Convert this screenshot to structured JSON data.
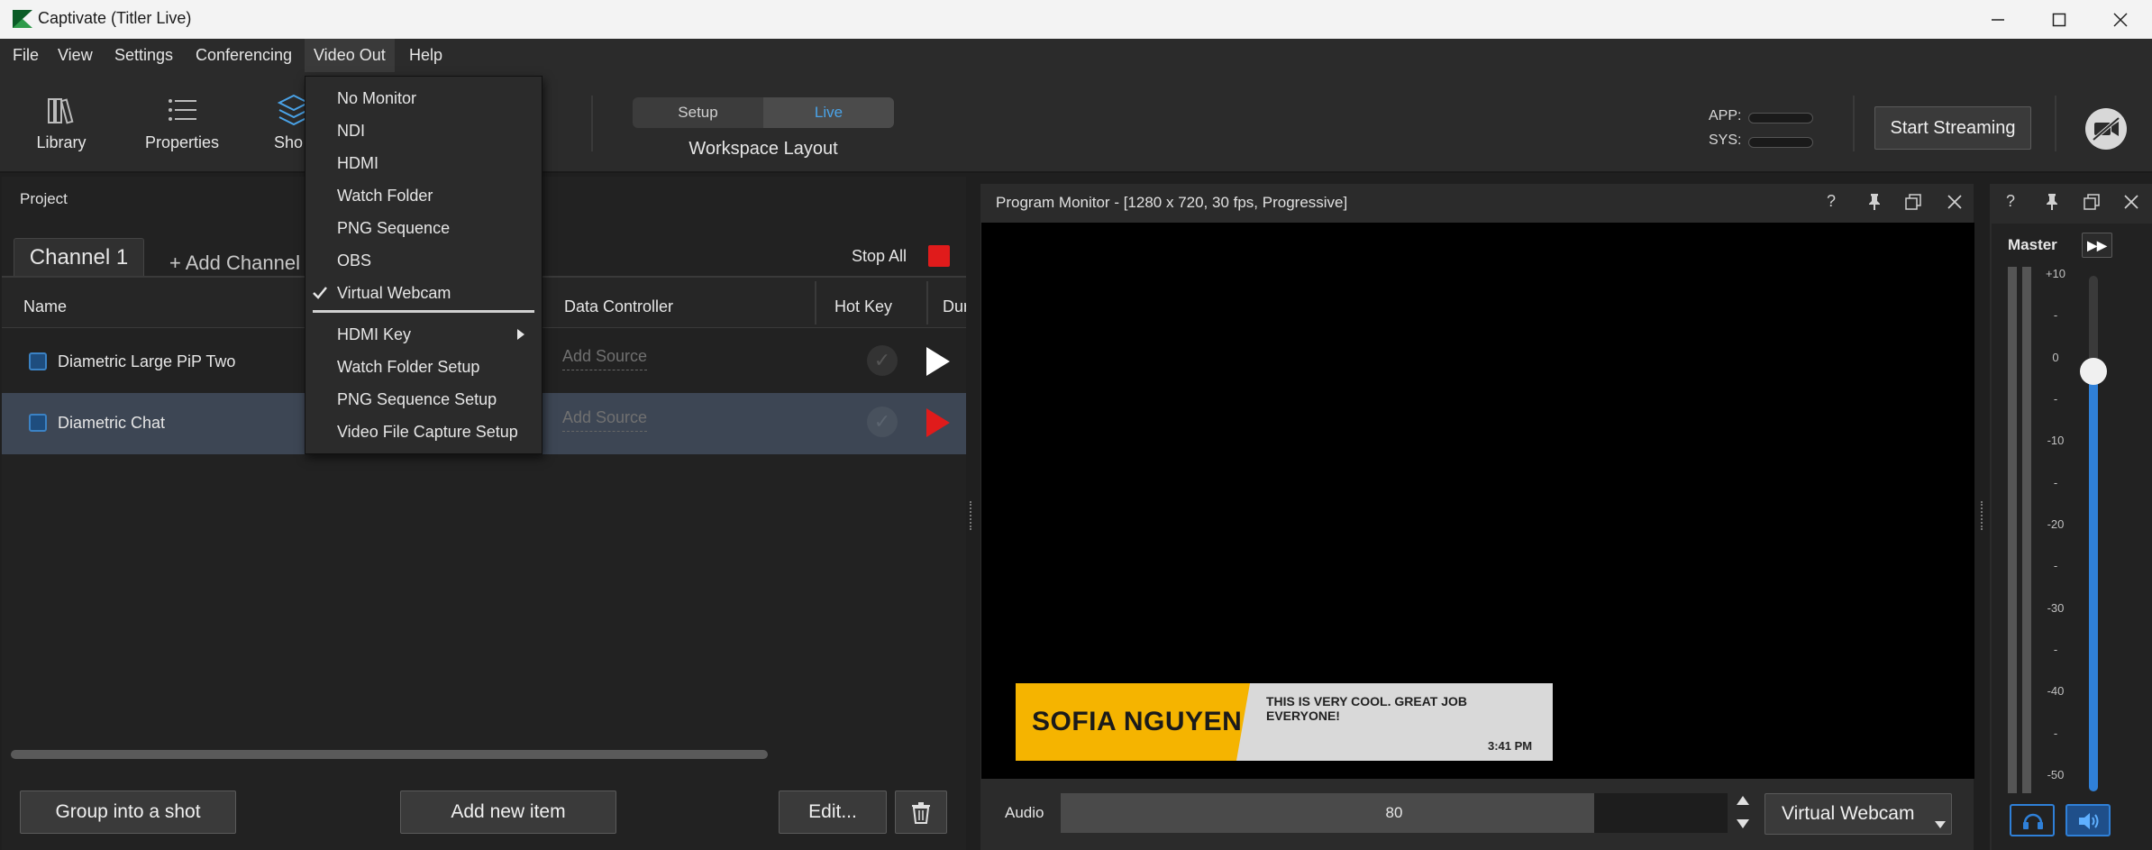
{
  "window": {
    "title": "Captivate (Titler Live)"
  },
  "menu": {
    "file": "File",
    "view": "View",
    "settings": "Settings",
    "conferencing": "Conferencing",
    "video_out": "Video Out",
    "help": "Help"
  },
  "toolbar": {
    "library": "Library",
    "properties": "Properties",
    "shots": "Sho",
    "seg_setup": "Setup",
    "seg_live": "Live",
    "workspace_layout": "Workspace Layout",
    "app_label": "APP:",
    "sys_label": "SYS:",
    "start_streaming": "Start Streaming"
  },
  "video_out_menu": {
    "items": [
      "No Monitor",
      "NDI",
      "HDMI",
      "Watch Folder",
      "PNG Sequence",
      "OBS",
      "Virtual Webcam"
    ],
    "checked": "Virtual Webcam",
    "items2": [
      "HDMI Key",
      "Watch Folder Setup",
      "PNG Sequence Setup",
      "Video File Capture Setup"
    ]
  },
  "project": {
    "header": "Project",
    "tab": "Channel 1",
    "add_channel": "+ Add Channel",
    "stop_all": "Stop All",
    "columns": {
      "name": "Name",
      "data_controller": "Data Controller",
      "hot_key": "Hot Key",
      "duration": "Dur"
    },
    "rows": [
      {
        "name": "Diametric Large PiP Two",
        "source": "Add Source"
      },
      {
        "name": "Diametric Chat",
        "source": "Add Source"
      }
    ],
    "group_btn": "Group into a shot",
    "add_item_btn": "Add new item",
    "edit_btn": "Edit..."
  },
  "program_monitor": {
    "title": "Program Monitor - [1280 x 720, 30 fps, Progressive]",
    "lower_third": {
      "name": "SOFIA NGUYEN",
      "message": "THIS IS VERY COOL. GREAT JOB EVERYONE!",
      "time": "3:41 PM"
    },
    "audio_label": "Audio",
    "audio_value": 80,
    "audio_fraction": 0.8,
    "output_select": "Virtual Webcam"
  },
  "mixer": {
    "title": "Master",
    "scale": [
      "+10",
      "-",
      "0",
      "-",
      "-10",
      "-",
      "-20",
      "-",
      "-30",
      "-",
      "-40",
      "-",
      "-50"
    ]
  },
  "colors": {
    "accent": "#4aa3e8",
    "play_active": "#e01b1b",
    "stop_red": "#e01b1b",
    "lower_third_yellow": "#f5b400",
    "lower_third_gray": "#d9d9d9",
    "fader_blue": "#2f80d8"
  }
}
